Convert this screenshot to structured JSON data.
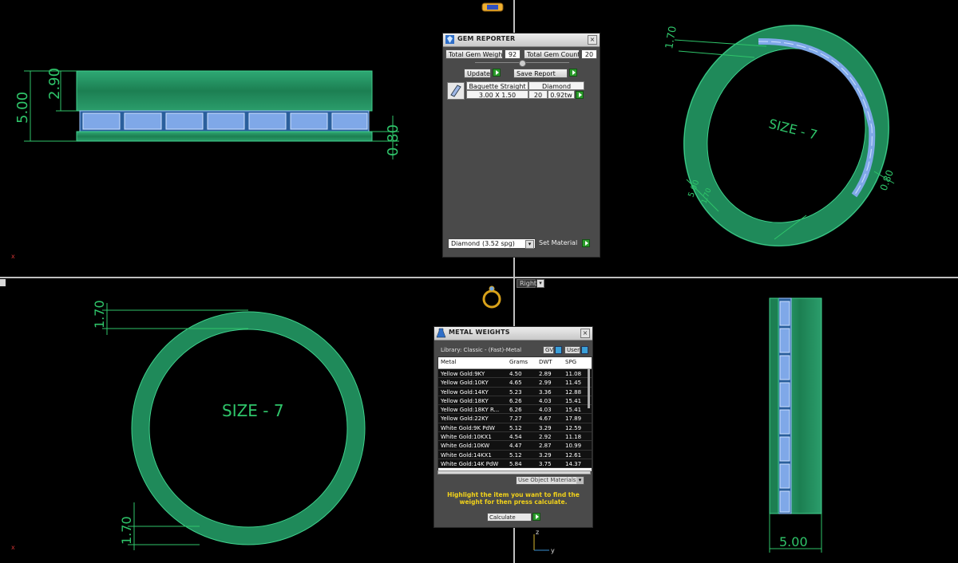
{
  "gem_reporter": {
    "title": "GEM REPORTER",
    "total_gem_weight_label": "Total Gem Weight",
    "total_gem_weight_value": "92",
    "total_gem_count_label": "Total Gem Count",
    "total_gem_count_value": "20",
    "update_label": "Update",
    "save_report_label": "Save Report",
    "table": {
      "cut": "Baguette Straight",
      "stone": "Diamond",
      "size": "3.00 X 1.50",
      "count": "20",
      "weight": "0.92tw"
    },
    "material_select": "Diamond",
    "material_spg": "(3.52 spg)",
    "set_material_label": "Set Material"
  },
  "metal_weights": {
    "title": "METAL WEIGHTS",
    "library": "Library: Classic - (Fast)-Metal",
    "gv_label": "GV",
    "user_label": "User",
    "columns": [
      "Metal",
      "Grams",
      "DWT",
      "SPG"
    ],
    "rows": [
      [
        "Yellow Gold:9KY",
        "4.50",
        "2.89",
        "11.08"
      ],
      [
        "Yellow Gold:10KY",
        "4.65",
        "2.99",
        "11.45"
      ],
      [
        "Yellow Gold:14KY",
        "5.23",
        "3.36",
        "12.88"
      ],
      [
        "Yellow Gold:18KY",
        "6.26",
        "4.03",
        "15.41"
      ],
      [
        "Yellow Gold:18KY R...",
        "6.26",
        "4.03",
        "15.41"
      ],
      [
        "Yellow Gold:22KY",
        "7.27",
        "4.67",
        "17.89"
      ],
      [
        "White Gold:9K PdW",
        "5.12",
        "3.29",
        "12.59"
      ],
      [
        "White Gold:10KX1",
        "4.54",
        "2.92",
        "11.18"
      ],
      [
        "White Gold:10KW",
        "4.47",
        "2.87",
        "10.99"
      ],
      [
        "White Gold:14KX1",
        "5.12",
        "3.29",
        "12.61"
      ],
      [
        "White Gold:14K PdW",
        "5.84",
        "3.75",
        "14.37"
      ]
    ],
    "use_object_materials": "Use Object Materials",
    "hint": "Highlight the item you want to find the weight for then press calculate.",
    "calculate_select": "Calculate"
  },
  "viewports": {
    "view_label": "Right",
    "front_dims": {
      "total_height": "5.00",
      "upper": "2.90",
      "lower": "0.80"
    },
    "persp_dims": {
      "top": "1.70",
      "left_a": "5.00",
      "left_b": "1.70",
      "right": "0.80",
      "size_text": "SIZE - 7"
    },
    "top_dims": {
      "top": "1.70",
      "bottom": "1.70",
      "size_text": "SIZE - 7"
    },
    "side_dims": {
      "width": "5.00"
    },
    "axis_z": "z",
    "axis_y": "y",
    "axis_x": "x"
  },
  "colors": {
    "metal": "#1f8a5a",
    "metal_light": "#3fc28a",
    "stone": "#8fb8f2",
    "dimension": "#2fc56a",
    "background": "#000000"
  }
}
